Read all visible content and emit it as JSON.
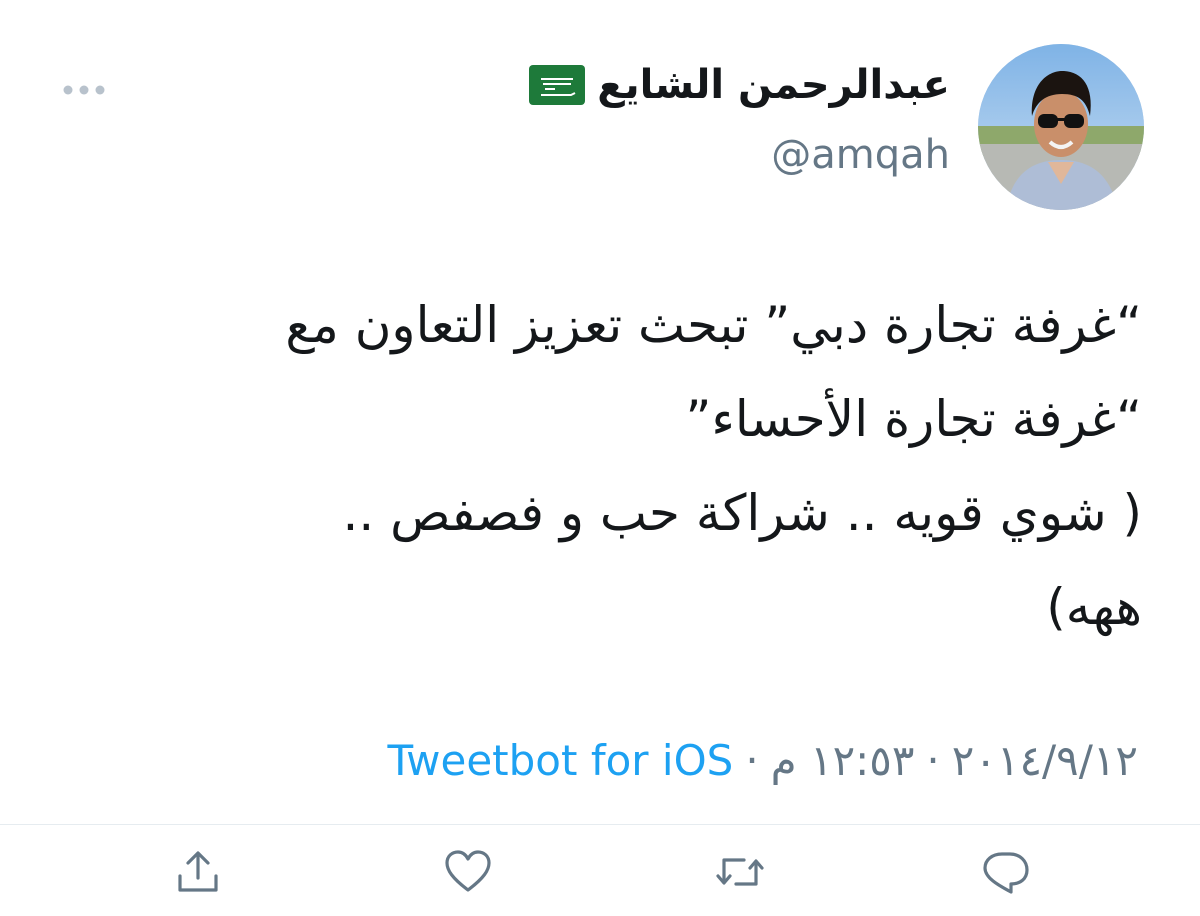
{
  "user": {
    "display_name": "عبدالرحمن الشايع",
    "flag": "saudi-arabia-flag-icon",
    "handle": "@amqah",
    "avatar": "user-avatar-photo"
  },
  "tweet": {
    "lines": [
      "“غرفة تجارة دبي” تبحث تعزيز التعاون مع",
      "“غرفة تجارة الأحساء”",
      "( شوي قويه .. شراكة حب و فصفص ..",
      "ههه)"
    ]
  },
  "meta": {
    "date": "٢٠١٤/٩/١٢",
    "time": "١٢:٥٣ م",
    "separator": "·",
    "source": "Tweetbot for iOS"
  },
  "actions": {
    "reply_icon": "reply-icon",
    "retweet_icon": "retweet-icon",
    "like_icon": "heart-icon",
    "share_icon": "share-icon"
  },
  "colors": {
    "text": "#14171a",
    "secondary": "#657786",
    "link": "#1da1f2",
    "icon": "#657786"
  }
}
